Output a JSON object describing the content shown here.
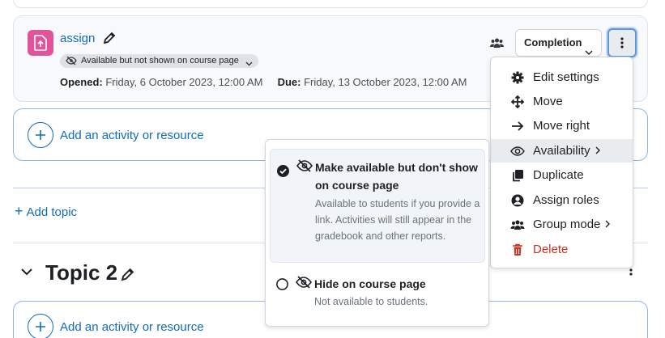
{
  "activity": {
    "name": "assign",
    "availability_badge": "Available but not shown on course page",
    "opened_label": "Opened:",
    "opened_value": "Friday, 6 October 2023, 12:00 AM",
    "due_label": "Due:",
    "due_value": "Friday, 13 October 2023, 12:00 AM",
    "completion_label": "Completion",
    "icon_color": "#e1549b"
  },
  "add_activity": {
    "label": "Add an activity or resource"
  },
  "add_topic_label": "Add topic",
  "topic": {
    "title": "Topic 2"
  },
  "menu": {
    "items": [
      {
        "label": "Edit settings",
        "icon": "gear-icon"
      },
      {
        "label": "Move",
        "icon": "move-arrows-icon"
      },
      {
        "label": "Move right",
        "icon": "arrow-right-icon"
      },
      {
        "label": "Availability",
        "icon": "eye-icon"
      },
      {
        "label": "Duplicate",
        "icon": "copy-icon"
      },
      {
        "label": "Assign roles",
        "icon": "user-circle-icon"
      },
      {
        "label": "Group mode",
        "icon": "users-icon"
      },
      {
        "label": "Delete",
        "icon": "trash-icon"
      }
    ]
  },
  "availability_submenu": {
    "options": [
      {
        "title": "Make available but don't show on course page",
        "description": "Available to students if you provide a link. Activities will still appear in the gradebook and other reports.",
        "selected": true
      },
      {
        "title": "Hide on course page",
        "description": "Not available to students.",
        "selected": false
      }
    ]
  },
  "colors": {
    "link": "#0f6cbf",
    "danger": "#ca3120",
    "focus_ring": "#5d97d4"
  }
}
